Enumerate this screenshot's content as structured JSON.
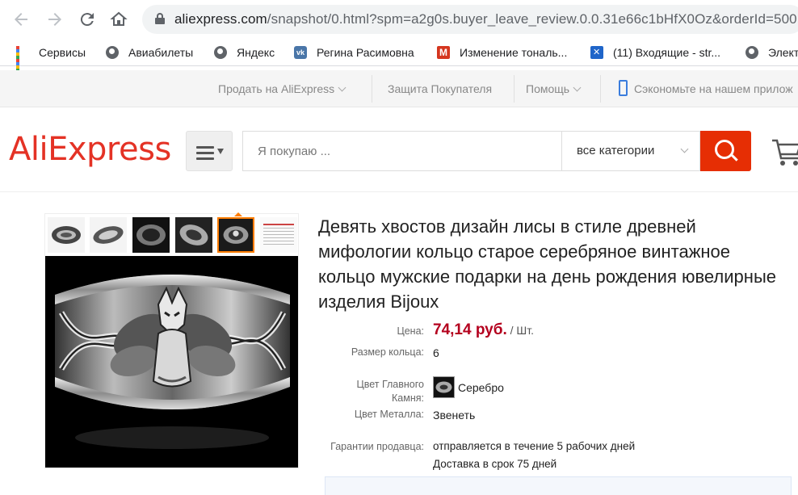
{
  "browser": {
    "url_host": "aliexpress.com",
    "url_rest": "/snapshot/0.html?spm=a2g0s.buyer_leave_review.0.0.31e66c1bHfX0Oz&orderId=500",
    "bookmarks": [
      {
        "label": "Сервисы",
        "icon": "apps-icon"
      },
      {
        "label": "Авиабилеты",
        "icon": "globe-icon"
      },
      {
        "label": "Яндекс",
        "icon": "globe-icon"
      },
      {
        "label": "Регина Расимовна",
        "icon": "vk-icon"
      },
      {
        "label": "Изменение тональ...",
        "icon": "m-icon"
      },
      {
        "label": "(11) Входящие - str...",
        "icon": "mail-icon"
      },
      {
        "label": "Элект",
        "icon": "globe-icon"
      }
    ]
  },
  "topbar": {
    "sell": "Продать на AliExpress",
    "protection": "Защита Покупателя",
    "help": "Помощь",
    "app": "Сэкономьте на нашем прилож"
  },
  "header": {
    "logo": "AliExpress",
    "search_placeholder": "Я покупаю ...",
    "category": "все категории"
  },
  "product": {
    "title": "Девять хвостов дизайн лисы в стиле древней мифологии кольцо старое серебряное винтажное кольцо мужские подарки на день рождения ювелирные изделия Bijoux",
    "price_label": "Цена:",
    "price": "74,14 руб.",
    "price_unit": "/ Шт.",
    "size_label": "Размер кольца:",
    "size_value": "6",
    "stone_label_1": "Цвет Главного",
    "stone_label_2": "Камня:",
    "stone_value": "Серебро",
    "metal_label": "Цвет Металла:",
    "metal_value": "Звенеть",
    "guarantee_label": "Гарантии продавца:",
    "guarantee_line1": "отправляется в течение 5 рабочих дней",
    "guarantee_line2": "Доставка в срок 75 дней"
  },
  "colors": {
    "brand": "#e43225",
    "search_button": "#e62e04",
    "price": "#b4001e"
  }
}
